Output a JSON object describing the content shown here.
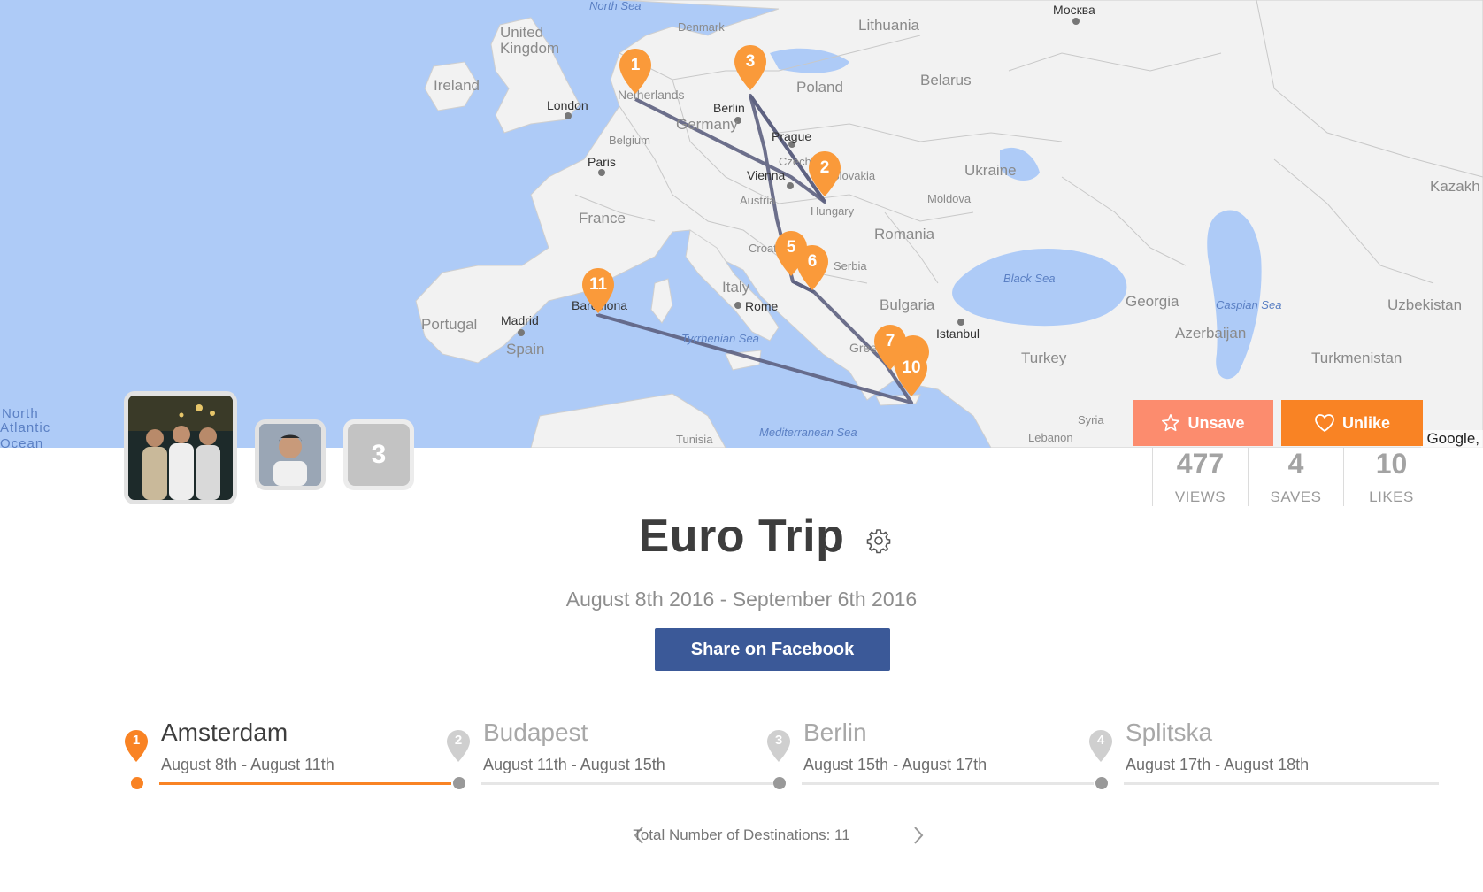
{
  "map": {
    "countries": [
      "Lithuania",
      "Belarus",
      "Poland",
      "Ukraine",
      "Ireland",
      "United Kingdom",
      "Netherlands",
      "Germany",
      "Belgium",
      "France",
      "Portugal",
      "Spain",
      "Italy",
      "Czechia",
      "Austria",
      "Hungary",
      "Croatia",
      "Serbia",
      "Romania",
      "Bulgaria",
      "Greece",
      "Turkey",
      "Georgia",
      "Azerbaijan",
      "Uzbekistan",
      "Turkmenistan",
      "Kazakh",
      "Moldova",
      "Slovakia",
      "Syria",
      "Lebanon",
      "Tunisia",
      "Denmark"
    ],
    "cities": [
      "Москва",
      "London",
      "Paris",
      "Berlin",
      "Prague",
      "Vienna",
      "Rome",
      "Madrid",
      "Barcelona",
      "Istanbul"
    ],
    "seas": [
      "Black Sea",
      "Caspian Sea",
      "Mediterranean Sea",
      "Tyrrhenian Sea",
      "North Sea"
    ],
    "ocean": [
      "North",
      "Atlantic",
      "Ocean"
    ],
    "attribution": "Google,",
    "route_color": "#5d6080",
    "pin_color": "#fa9a3a",
    "pins": [
      "1",
      "3",
      "2",
      "5",
      "6",
      "11",
      "7",
      "10"
    ]
  },
  "actions": {
    "unsave_label": "Unsave",
    "unlike_label": "Unlike"
  },
  "travelers": {
    "extra_count": "3"
  },
  "stats": [
    {
      "value": "477",
      "label": "VIEWS"
    },
    {
      "value": "4",
      "label": "SAVES"
    },
    {
      "value": "10",
      "label": "LIKES"
    }
  ],
  "trip": {
    "title": "Euro Trip",
    "dates": "August 8th 2016 - September 6th 2016",
    "share_label": "Share on Facebook"
  },
  "destinations": [
    {
      "num": "1",
      "name": "Amsterdam",
      "dates": "August 8th - August 11th",
      "active": true
    },
    {
      "num": "2",
      "name": "Budapest",
      "dates": "August 11th - August 15th",
      "active": false
    },
    {
      "num": "3",
      "name": "Berlin",
      "dates": "August 15th - August 17th",
      "active": false
    },
    {
      "num": "4",
      "name": "Splitska",
      "dates": "August 17th - August 18th",
      "active": false
    }
  ],
  "pager": {
    "text": "Total Number of Destinations: 11"
  },
  "colors": {
    "accent": "#f98324",
    "accent_light": "#fc8c6e",
    "facebook": "#3b5998",
    "inactive": "#b5b5b5"
  }
}
